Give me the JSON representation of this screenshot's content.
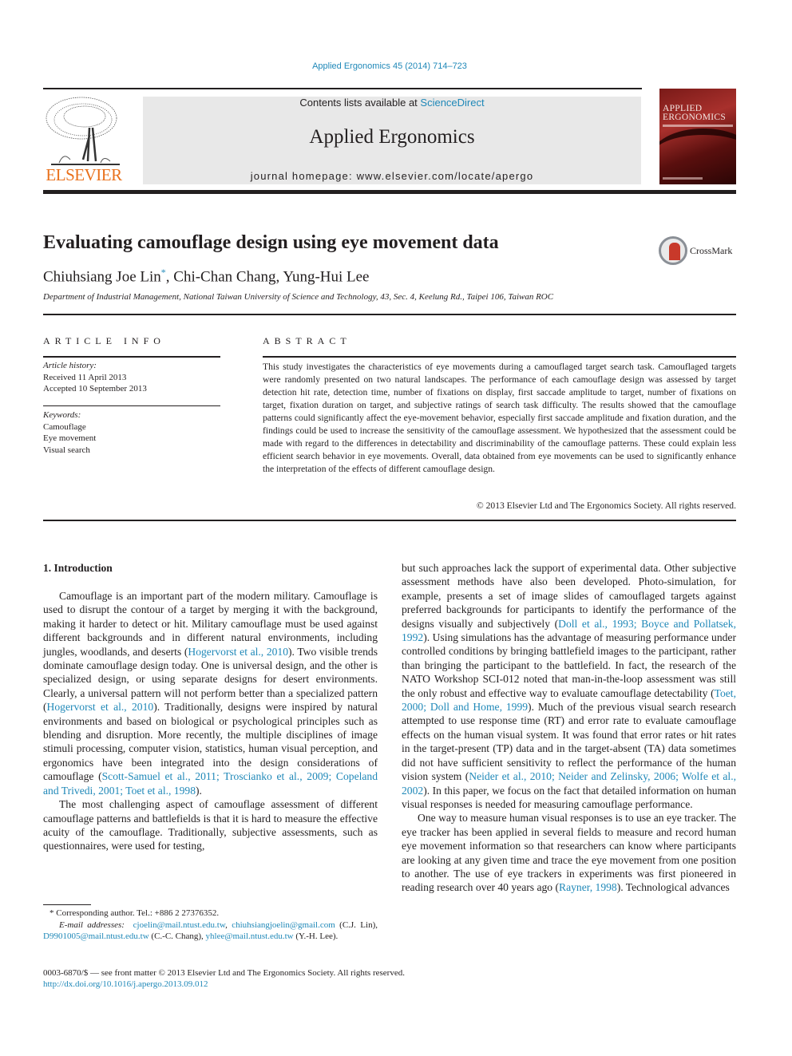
{
  "journal_citation": "Applied Ergonomics 45 (2014) 714–723",
  "header": {
    "publisher_logo_text": "ELSEVIER",
    "contents_prefix": "Contents lists available at ",
    "contents_link": "ScienceDirect",
    "journal_name": "Applied Ergonomics",
    "homepage_prefix": "journal homepage: ",
    "homepage_url": "www.elsevier.com/locate/apergo",
    "cover_title_line1": "APPLIED",
    "cover_title_line2": "ERGONOMICS"
  },
  "article": {
    "title": "Evaluating camouflage design using eye movement data",
    "crossmark_label": "CrossMark",
    "authors": [
      {
        "name": "Chiuhsiang Joe Lin",
        "mark": "*"
      },
      {
        "name": "Chi-Chan Chang",
        "mark": ""
      },
      {
        "name": "Yung-Hui Lee",
        "mark": ""
      }
    ],
    "author_separator": ", ",
    "affiliation": "Department of Industrial Management, National Taiwan University of Science and Technology, 43, Sec. 4, Keelung Rd., Taipei 106, Taiwan ROC"
  },
  "article_info": {
    "heading": "ARTICLE INFO",
    "history_label": "Article history:",
    "received": "Received 11 April 2013",
    "accepted": "Accepted 10 September 2013",
    "keywords_label": "Keywords:",
    "keywords": [
      "Camouflage",
      "Eye movement",
      "Visual search"
    ]
  },
  "abstract": {
    "heading": "ABSTRACT",
    "text": "This study investigates the characteristics of eye movements during a camouflaged target search task. Camouflaged targets were randomly presented on two natural landscapes. The performance of each camouflage design was assessed by target detection hit rate, detection time, number of fixations on display, first saccade amplitude to target, number of fixations on target, fixation duration on target, and subjective ratings of search task difficulty. The results showed that the camouflage patterns could significantly affect the eye-movement behavior, especially first saccade amplitude and fixation duration, and the findings could be used to increase the sensitivity of the camouflage assessment. We hypothesized that the assessment could be made with regard to the differences in detectability and discriminability of the camouflage patterns. These could explain less efficient search behavior in eye movements. Overall, data obtained from eye movements can be used to significantly enhance the interpretation of the effects of different camouflage design.",
    "copyright": "© 2013 Elsevier Ltd and The Ergonomics Society. All rights reserved."
  },
  "body": {
    "section_heading": "1.  Introduction",
    "left_column": [
      [
        {
          "t": "Camouflage is an important part of the modern military. Camouflage is used to disrupt the contour of a target by merging it with the background, making it harder to detect or hit. Military camouflage must be used against different backgrounds and in different natural environments, including jungles, woodlands, and deserts ("
        },
        {
          "t": "Hogervorst et al., 2010",
          "link": true
        },
        {
          "t": "). Two visible trends dominate camouflage design today. One is universal design, and the other is specialized design, or using separate designs for desert environments. Clearly, a universal pattern will not perform better than a specialized pattern ("
        },
        {
          "t": "Hogervorst et al., 2010",
          "link": true
        },
        {
          "t": "). Traditionally, designs were inspired by natural environments and based on biological or psychological principles such as blending and disruption. More recently, the multiple disciplines of image stimuli processing, computer vision, statistics, human visual perception, and ergonomics have been integrated into the design considerations of camouflage ("
        },
        {
          "t": "Scott-Samuel et al., 2011; Troscianko et al., 2009; Copeland and Trivedi, 2001; Toet et al., 1998",
          "link": true
        },
        {
          "t": ")."
        }
      ],
      [
        {
          "t": "The most challenging aspect of camouflage assessment of different camouflage patterns and battlefields is that it is hard to measure the effective acuity of the camouflage. Traditionally, subjective assessments, such as questionnaires, were used for testing,"
        }
      ]
    ],
    "right_column": [
      [
        {
          "t": "but such approaches lack the support of experimental data. Other subjective assessment methods have also been developed. Photo-simulation, for example, presents a set of image slides of camouflaged targets against preferred backgrounds for participants to identify the performance of the designs visually and subjectively ("
        },
        {
          "t": "Doll et al., 1993; Boyce and Pollatsek, 1992",
          "link": true
        },
        {
          "t": "). Using simulations has the advantage of measuring performance under controlled conditions by bringing battlefield images to the participant, rather than bringing the participant to the battlefield. In fact, the research of the NATO Workshop SCI-012 noted that man-in-the-loop assessment was still the only robust and effective way to evaluate camouflage detectability ("
        },
        {
          "t": "Toet, 2000; Doll and Home, 1999",
          "link": true
        },
        {
          "t": "). Much of the previous visual search research attempted to use response time (RT) and error rate to evaluate camouflage effects on the human visual system. It was found that error rates or hit rates in the target-present (TP) data and in the target-absent (TA) data sometimes did not have sufficient sensitivity to reflect the performance of the human vision system ("
        },
        {
          "t": "Neider et al., 2010; Neider and Zelinsky, 2006; Wolfe et al., 2002",
          "link": true
        },
        {
          "t": "). In this paper, we focus on the fact that detailed information on human visual responses is needed for measuring camouflage performance."
        }
      ],
      [
        {
          "t": "One way to measure human visual responses is to use an eye tracker. The eye tracker has been applied in several fields to measure and record human eye movement information so that researchers can know where participants are looking at any given time and trace the eye movement from one position to another. The use of eye trackers in experiments was first pioneered in reading research over 40 years ago ("
        },
        {
          "t": "Rayner, 1998",
          "link": true
        },
        {
          "t": "). Technological advances"
        }
      ]
    ]
  },
  "footnote": {
    "corresponding": "* Corresponding author. Tel.: +886 2 27376352.",
    "email_label": "E-mail addresses:",
    "emails": [
      {
        "addr": "cjoelin@mail.ntust.edu.tw",
        "who": ","
      },
      {
        "addr": "chiuhsiangjoelin@gmail.com",
        "who": " (C.J. Lin),"
      },
      {
        "addr": "D9901005@mail.ntust.edu.tw",
        "who": " (C.-C. Chang),"
      },
      {
        "addr": "yhlee@mail.ntust.edu.tw",
        "who": " (Y.-H. Lee)."
      }
    ]
  },
  "bottom": {
    "front_matter": "0003-6870/$ — see front matter © 2013 Elsevier Ltd and The Ergonomics Society. All rights reserved.",
    "doi": "http://dx.doi.org/10.1016/j.apergo.2013.09.012"
  }
}
